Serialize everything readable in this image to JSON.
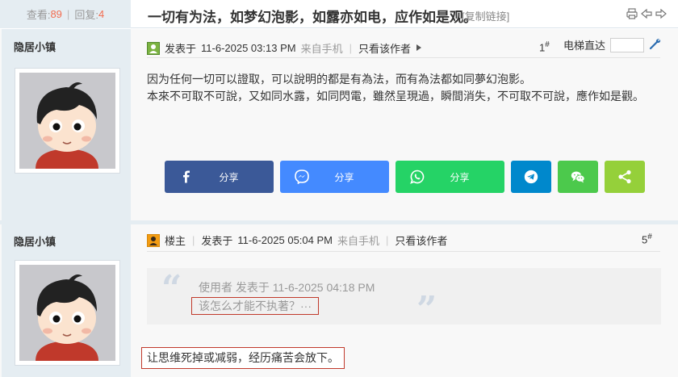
{
  "header": {
    "views_label": "查看:",
    "views_count": "89",
    "replies_label": "回复:",
    "replies_count": "4",
    "separator": "|",
    "title": "一切有为法，如梦幻泡影，如露亦如电，应作如是观。",
    "copy_link": "[复制链接]",
    "icons": [
      "print-icon",
      "prev-thread-icon",
      "next-thread-icon"
    ]
  },
  "post1": {
    "author": "隐居小镇",
    "meta_prefix": "发表于",
    "timestamp": "11-6-2025 03:13 PM",
    "source": "来自手机",
    "view_author_only": "只看该作者",
    "floor": "1",
    "floor_mark": "#",
    "jump_label": "电梯直达",
    "jump_value": "",
    "content_lines": [
      "因为任何一切可以證取，可以說明的都是有為法，而有為法都如同夢幻泡影。",
      "本來不可取不可說，又如同水露，如同閃電，雖然呈現過，瞬間消失，不可取不可說，應作如是觀。"
    ],
    "share_buttons": [
      {
        "name": "facebook",
        "label": "分享",
        "color": "#3b5998"
      },
      {
        "name": "messenger",
        "label": "分享",
        "color": "#448aff"
      },
      {
        "name": "whatsapp",
        "label": "分享",
        "color": "#25d366"
      },
      {
        "name": "telegram",
        "label": "",
        "color": "#0088cc"
      },
      {
        "name": "wechat",
        "label": "",
        "color": "#4cc94c"
      },
      {
        "name": "sharethis",
        "label": "",
        "color": "#95d03a"
      }
    ]
  },
  "post2": {
    "author": "隐居小镇",
    "role": "楼主",
    "meta_prefix": "发表于",
    "timestamp": "11-6-2025 05:04 PM",
    "source": "来自手机",
    "view_author_only": "只看该作者",
    "floor": "5",
    "floor_mark": "#",
    "quote_meta": "使用者 发表于 11-6-2025 04:18 PM",
    "quote_text": "该怎么才能不执著？···",
    "reply": "让思维死掉或减弱，经历痛苦会放下。"
  }
}
